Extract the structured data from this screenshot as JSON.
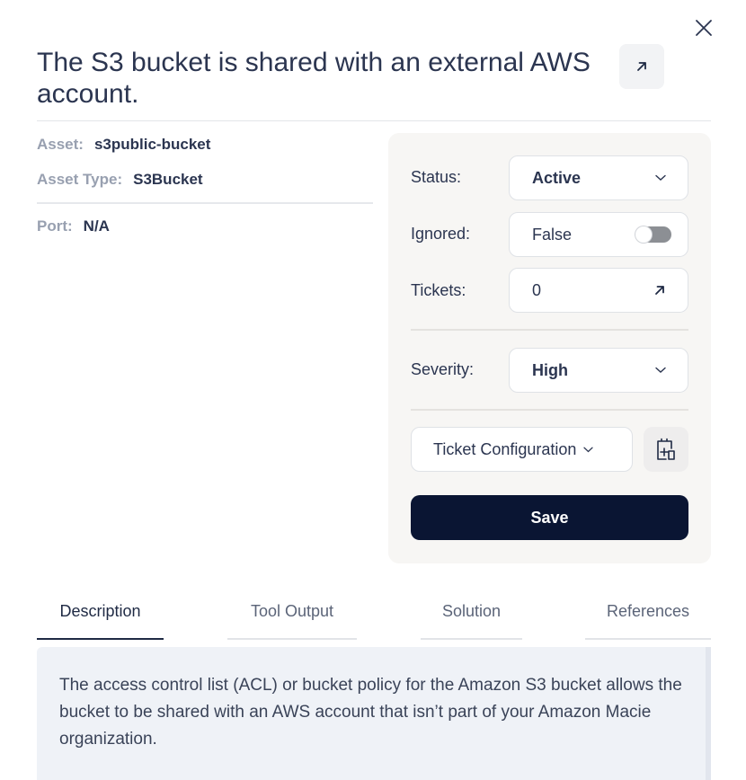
{
  "header": {
    "title": "The S3 bucket is shared with an external AWS account."
  },
  "asset": {
    "asset_label": "Asset:",
    "asset_value": "s3public-bucket",
    "type_label": "Asset Type:",
    "type_value": "S3Bucket",
    "port_label": "Port:",
    "port_value": "N/A"
  },
  "panel": {
    "status_label": "Status:",
    "status_value": "Active",
    "ignored_label": "Ignored:",
    "ignored_value": "False",
    "ignored_toggle_on": false,
    "tickets_label": "Tickets:",
    "tickets_value": "0",
    "severity_label": "Severity:",
    "severity_value": "High",
    "ticket_config_label": "Ticket Configuration",
    "save_label": "Save"
  },
  "tabs": [
    {
      "label": "Description",
      "active": true
    },
    {
      "label": "Tool Output",
      "active": false
    },
    {
      "label": "Solution",
      "active": false
    },
    {
      "label": "References",
      "active": false
    }
  ],
  "description": {
    "text": "The access control list (ACL) or bucket policy for the Amazon S3 bucket allows the bucket to be shared with an AWS account that isn’t part of your Amazon Macie organization."
  },
  "icons": {
    "close": "close-icon",
    "open_external": "arrow-up-right-icon",
    "chevron": "chevron-down-icon",
    "add_ticket": "add-ticket-icon"
  },
  "colors": {
    "primary": "#0a1533",
    "panel_bg": "#f7f6f4",
    "description_bg": "#eff2f7",
    "muted_label": "#98a0b0"
  }
}
